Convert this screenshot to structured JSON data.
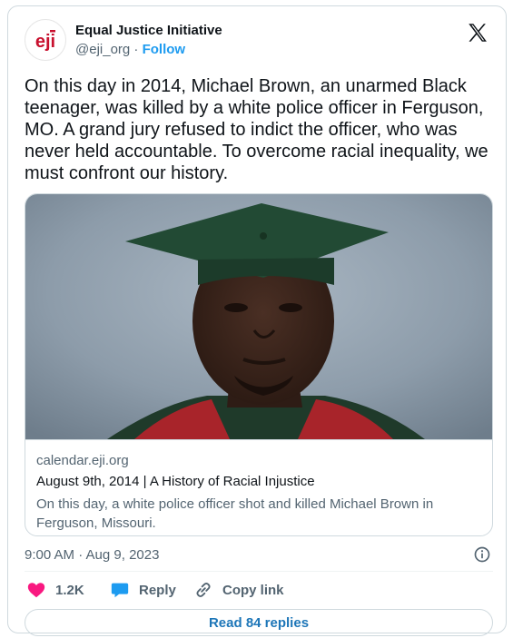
{
  "account": {
    "name": "Equal Justice Initiative",
    "handle": "@eji_org",
    "separator": " · ",
    "follow_label": "Follow",
    "avatar_text": "eji",
    "avatar_color": "#c8102e"
  },
  "tweet": {
    "text": "On this day in 2014, Michael Brown, an unarmed Black teenager, was killed by a white police officer in Ferguson, MO. A grand jury refused to indict the officer, who was never held accountable. To overcome racial inequality, we must confront our history."
  },
  "link_card": {
    "domain": "calendar.eji.org",
    "title": "August 9th, 2014 | A History of Racial Injustice",
    "description": "On this day, a white police officer shot and killed Michael Brown in Ferguson, Missouri."
  },
  "meta": {
    "timestamp": "9:00 AM · Aug 9, 2023"
  },
  "actions": {
    "like_count": "1.2K",
    "reply_label": "Reply",
    "copy_link_label": "Copy link"
  },
  "read_replies_label": "Read 84 replies",
  "colors": {
    "like": "#f91880",
    "reply": "#1d9bf0",
    "link": "#1d9bf0"
  },
  "icons": [
    "x-logo-icon",
    "heart-icon",
    "reply-bubble-icon",
    "link-icon",
    "info-icon"
  ]
}
